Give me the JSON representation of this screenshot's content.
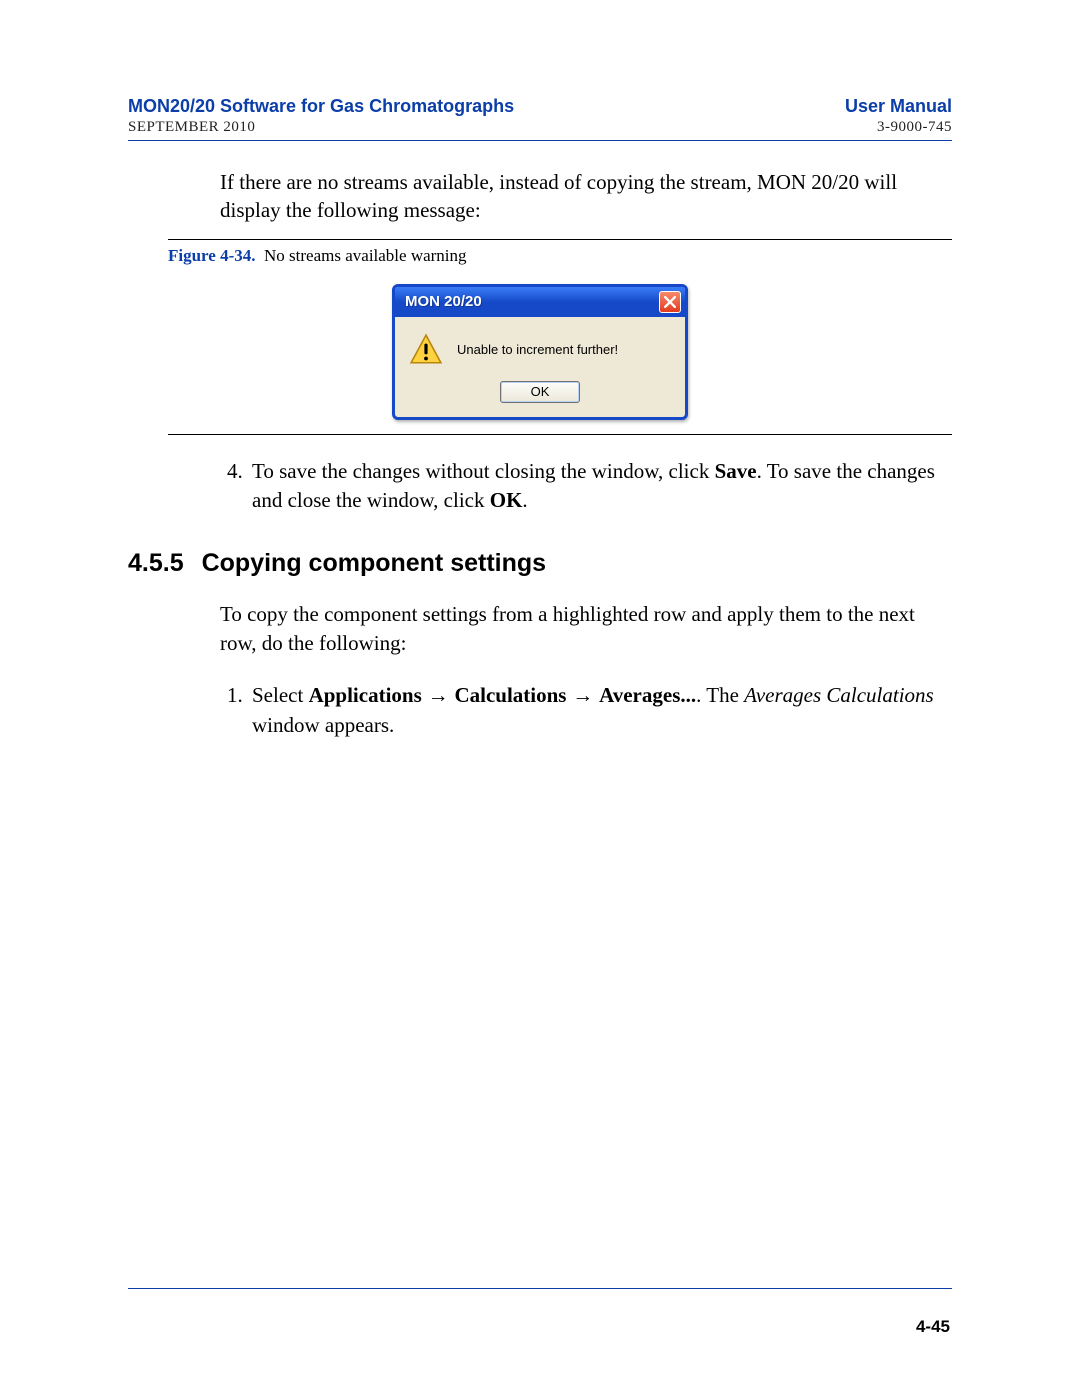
{
  "header": {
    "left_title": "MON20/20 Software for Gas Chromatographs",
    "right_title": "User Manual",
    "left_sub": "SEPTEMBER 2010",
    "right_sub": "3-9000-745"
  },
  "intro_para": "If there are no streams available, instead of copying the stream, MON 20/20 will display the following message:",
  "figure": {
    "label": "Figure 4-34.",
    "caption": "No streams available warning"
  },
  "dialog": {
    "title": "MON 20/20",
    "message": "Unable to increment further!",
    "ok": "OK"
  },
  "step4": {
    "pre": "To save the changes without closing the window, click ",
    "save": "Save",
    "mid": ". To save the changes and close the window, click ",
    "ok": "OK",
    "post": "."
  },
  "section": {
    "number": "4.5.5",
    "title": "Copying component settings"
  },
  "sect_intro": "To copy the component settings from a highlighted row and apply them to the next row, do the following:",
  "step1": {
    "pre": "Select ",
    "path1": "Applications",
    "arrow": " → ",
    "path2": "Calculations",
    "path3": "Averages...",
    "after": ".  The ",
    "win": "Averages Calculations",
    "tail": " window appears."
  },
  "page_number": "4-45"
}
